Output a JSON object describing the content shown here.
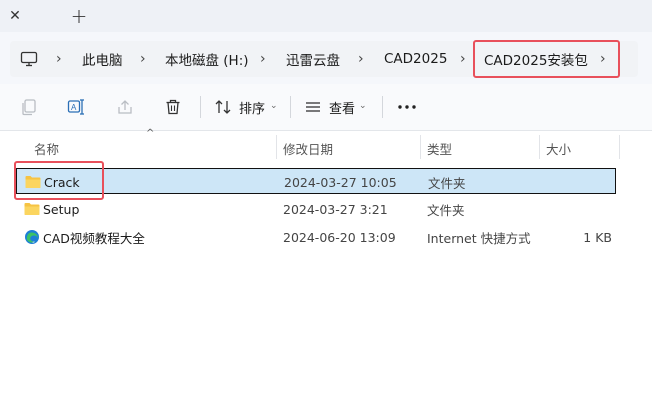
{
  "tabs": {
    "close_glyph": "✕",
    "new_glyph": "+"
  },
  "address": {
    "crumbs": [
      "此电脑",
      "本地磁盘 (H:)",
      "迅雷云盘",
      "CAD2025",
      "CAD2025安装包"
    ]
  },
  "toolbar": {
    "sort_label": "排序",
    "view_label": "查看"
  },
  "columns": {
    "name": "名称",
    "modified": "修改日期",
    "type": "类型",
    "size": "大小"
  },
  "files": [
    {
      "name": "Crack",
      "modified": "2024-03-27 10:05",
      "type": "文件夹",
      "size": "",
      "icon": "folder-icon"
    },
    {
      "name": "Setup",
      "modified": "2024-03-27 3:21",
      "type": "文件夹",
      "size": "",
      "icon": "folder-icon"
    },
    {
      "name": "CAD视频教程大全",
      "modified": "2024-06-20 13:09",
      "type": "Internet 快捷方式",
      "size": "1 KB",
      "icon": "edge-icon"
    }
  ],
  "colors": {
    "highlight": "#e8505b",
    "selection": "#cde6f7",
    "folder": "#f6c343"
  }
}
